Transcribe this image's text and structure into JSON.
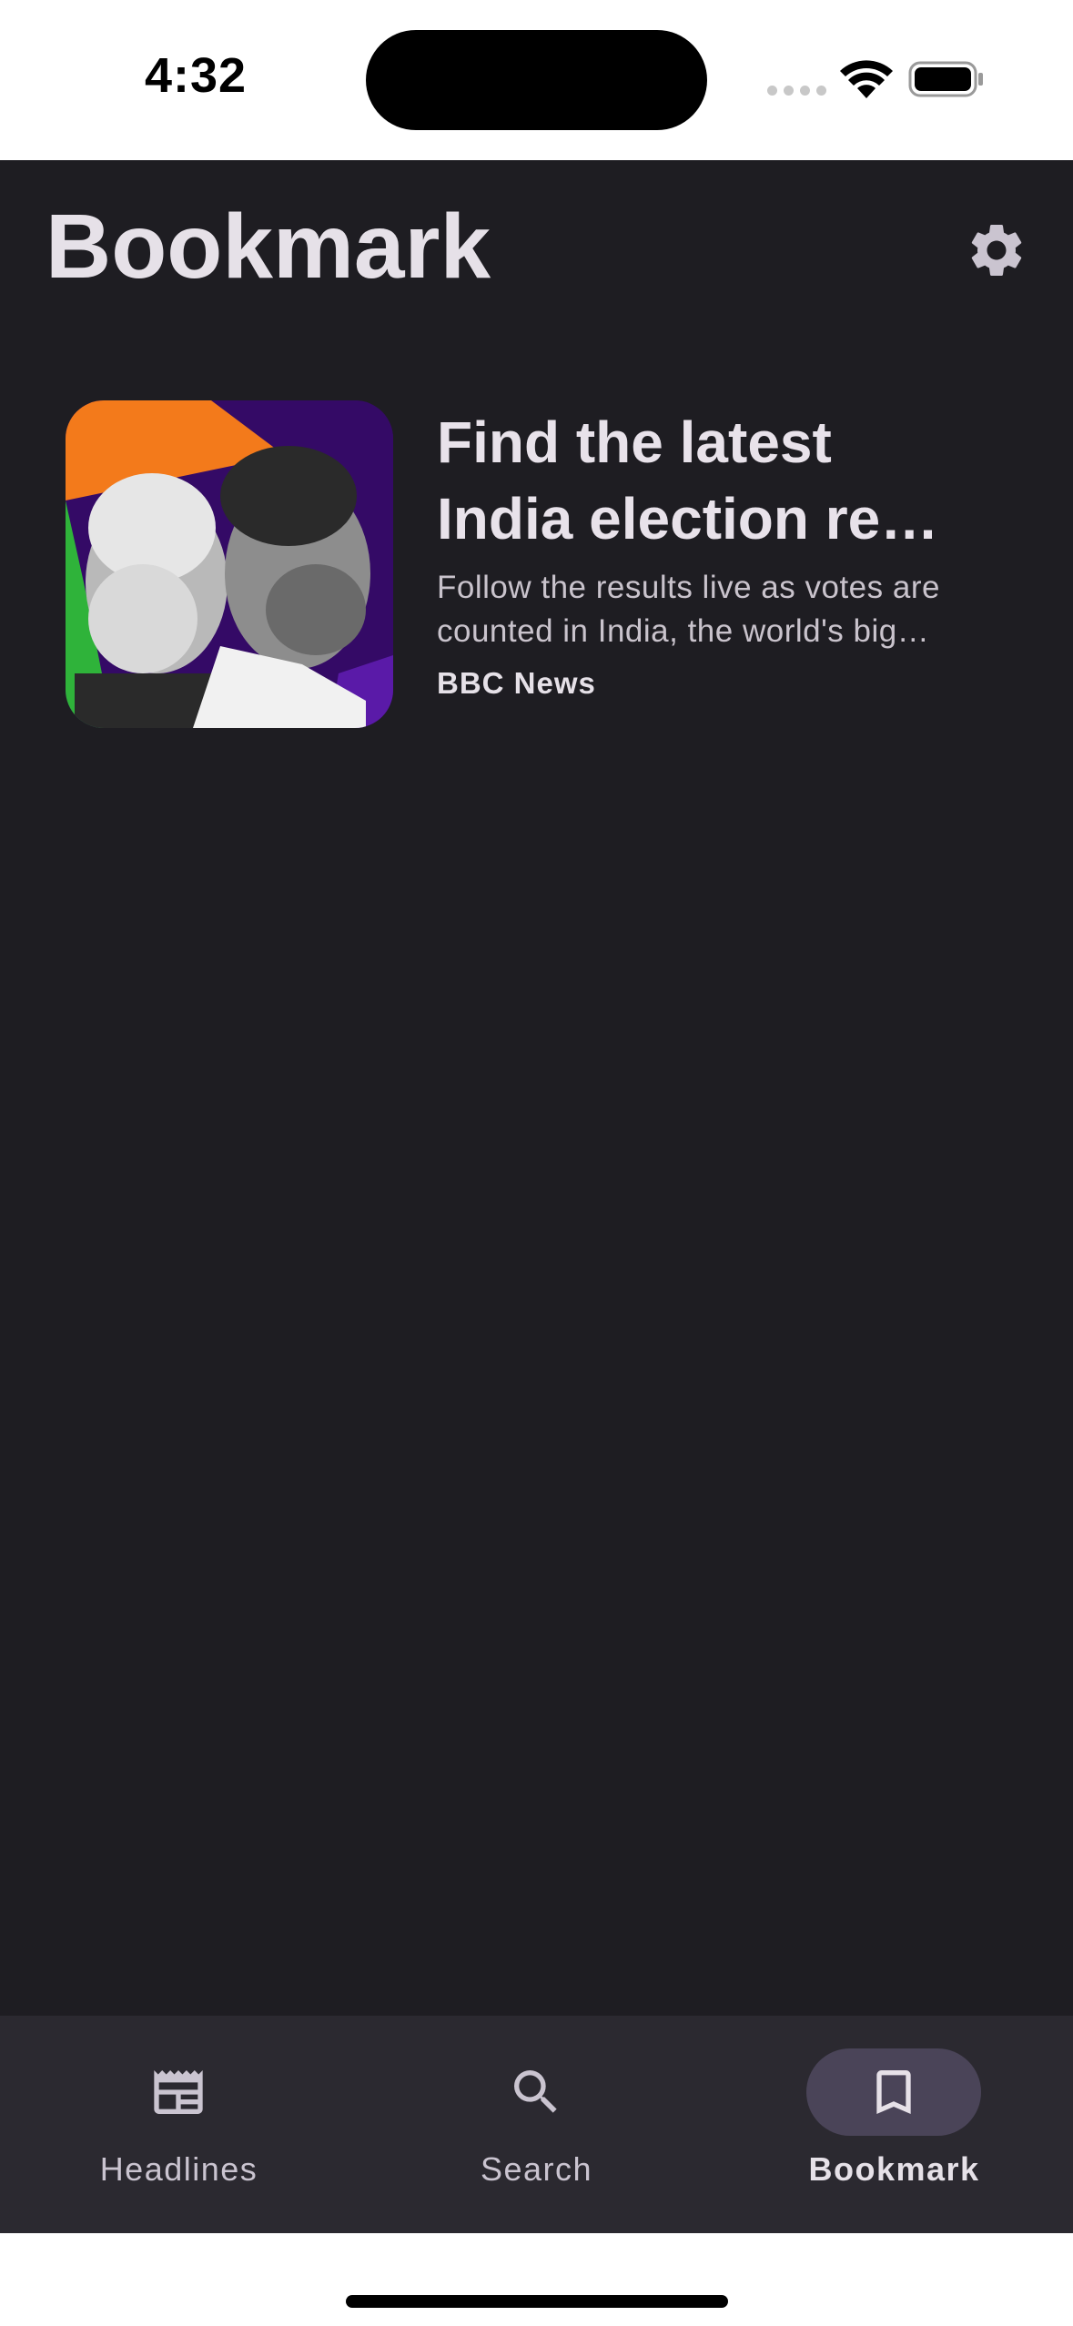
{
  "status_bar": {
    "time": "4:32"
  },
  "header": {
    "title": "Bookmark",
    "settings_icon": "gear-icon"
  },
  "bookmarks": [
    {
      "title": "Find the latest\nIndia election re…",
      "summary": "Follow the results live as votes are\ncounted in India, the world's big…",
      "source": "BBC News"
    }
  ],
  "bottom_nav": {
    "items": [
      {
        "label": "Headlines",
        "icon": "newspaper-icon",
        "active": false
      },
      {
        "label": "Search",
        "icon": "search-icon",
        "active": false
      },
      {
        "label": "Bookmark",
        "icon": "bookmark-icon",
        "active": true
      }
    ]
  },
  "colors": {
    "background": "#1e1d22",
    "nav_background": "#2b2930",
    "active_pill": "#4a4458",
    "text_primary": "#e6e1e8",
    "text_secondary": "#cac4d0"
  }
}
